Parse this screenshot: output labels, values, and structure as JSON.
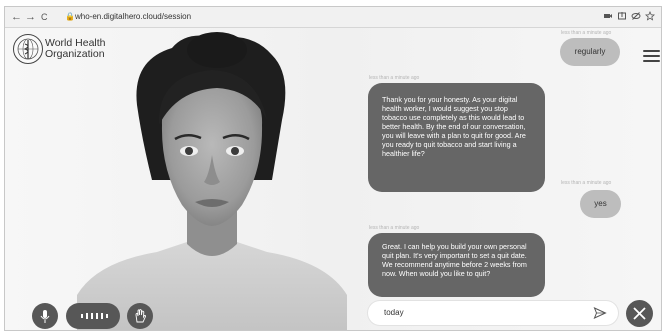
{
  "browser": {
    "url": "who-en.digitalhero.cloud/session",
    "nav_back": "←",
    "nav_forward": "→",
    "nav_reload": "C"
  },
  "org": {
    "name_line1": "World Health",
    "name_line2": "Organization"
  },
  "chat": {
    "messages": [
      {
        "role": "user",
        "text": "regularly",
        "timestamp": "less than a minute ago"
      },
      {
        "role": "agent",
        "text": "Thank you for your honesty. As your digital health worker, I would suggest you stop tobacco use completely as this would lead to better health. By the end of our conversation, you will leave with a plan to quit for good. Are you ready to quit tobacco and start living a healthier life?",
        "timestamp": "less than a minute ago"
      },
      {
        "role": "user",
        "text": "yes",
        "timestamp": "less than a minute ago"
      },
      {
        "role": "agent",
        "text": "Great. I can help you build your own personal quit plan. It's very important to set a quit date. We recommend anytime before 2 weeks from now. When would you like to quit?",
        "timestamp": "less than a minute ago"
      }
    ]
  },
  "input": {
    "value": "today"
  },
  "colors": {
    "agent_bubble": "#666666",
    "user_bubble": "#bdbdbd",
    "control": "#575757"
  }
}
